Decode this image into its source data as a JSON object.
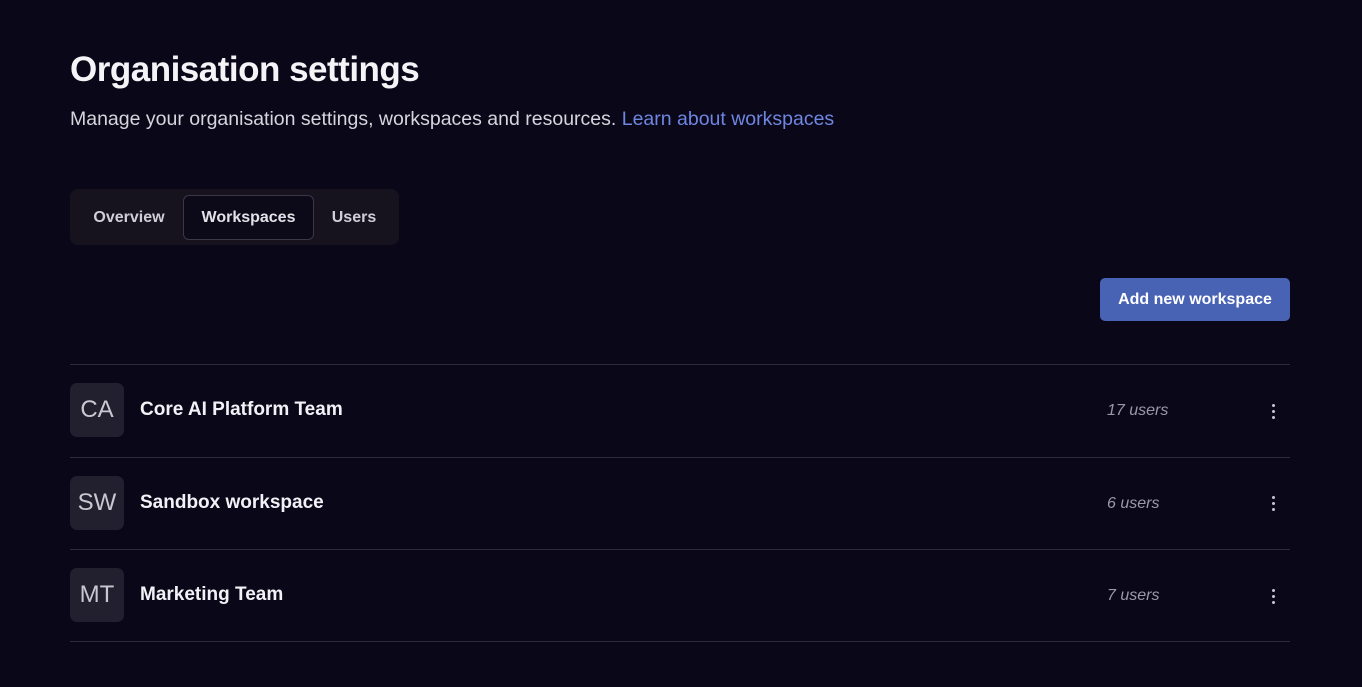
{
  "header": {
    "title": "Organisation settings",
    "subtitle": "Manage your organisation settings, workspaces and resources.",
    "learn_link": "Learn about workspaces"
  },
  "tabs": [
    {
      "label": "Overview",
      "active": false
    },
    {
      "label": "Workspaces",
      "active": true
    },
    {
      "label": "Users",
      "active": false
    }
  ],
  "add_button": "Add new workspace",
  "workspaces": [
    {
      "initials": "CA",
      "name": "Core AI Platform Team",
      "users": "17 users"
    },
    {
      "initials": "SW",
      "name": "Sandbox workspace",
      "users": "6 users"
    },
    {
      "initials": "MT",
      "name": "Marketing Team",
      "users": "7 users"
    }
  ],
  "icons": {
    "row_menu": "more-vertical-icon"
  },
  "colors": {
    "background": "#0a0719",
    "accent": "#4862b4",
    "link": "#6f86e0"
  }
}
